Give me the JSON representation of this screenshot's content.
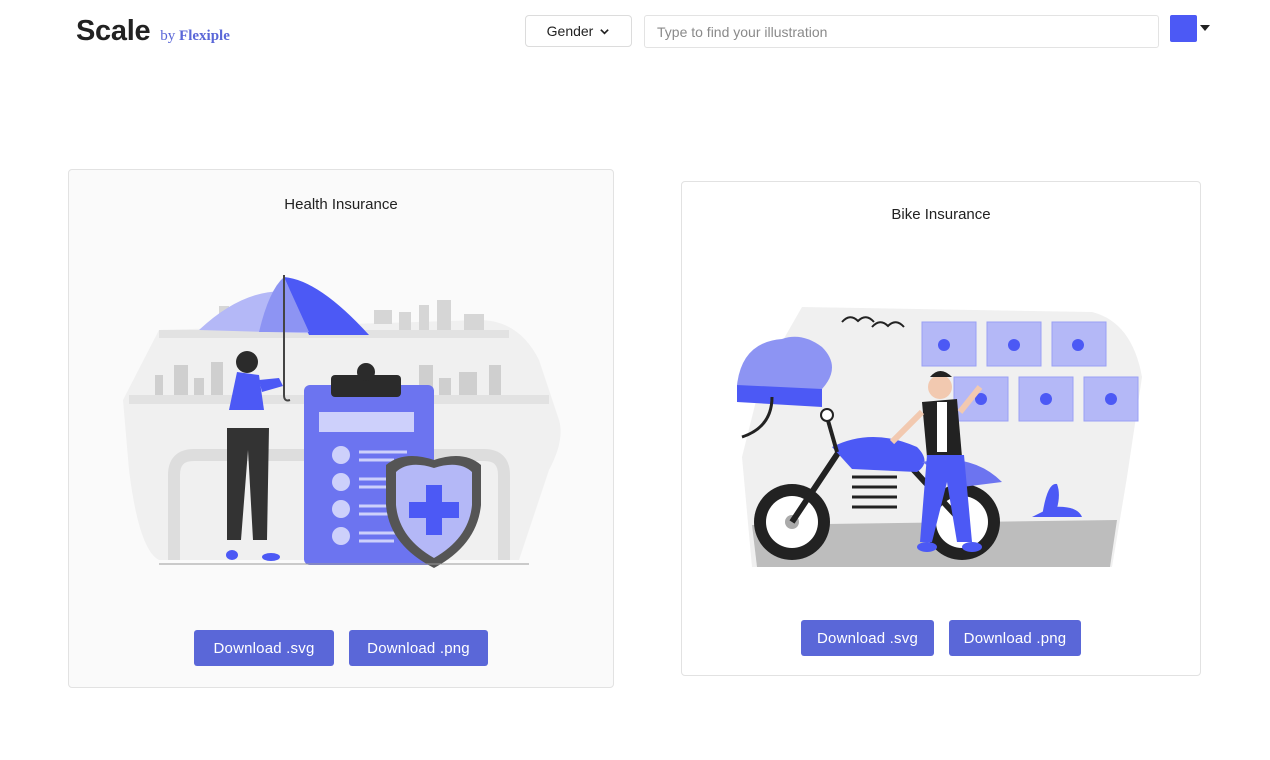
{
  "header": {
    "logo": "Scale",
    "by": "by",
    "brand": "Flexiple",
    "gender_label": "Gender",
    "search_placeholder": "Type to find your illustration",
    "accent_color": "#4c59f5"
  },
  "cards": [
    {
      "title": "Health Insurance",
      "download_svg": "Download .svg",
      "download_png": "Download .png"
    },
    {
      "title": "Bike Insurance",
      "download_svg": "Download .svg",
      "download_png": "Download .png"
    }
  ],
  "colors": {
    "button": "#5a67d8",
    "illustration_primary": "#6c74f0",
    "illustration_light": "#b4b8f7"
  },
  "icons": [
    "chevron-down-icon",
    "caret-down-icon",
    "check-icon",
    "shield-plus-icon"
  ]
}
